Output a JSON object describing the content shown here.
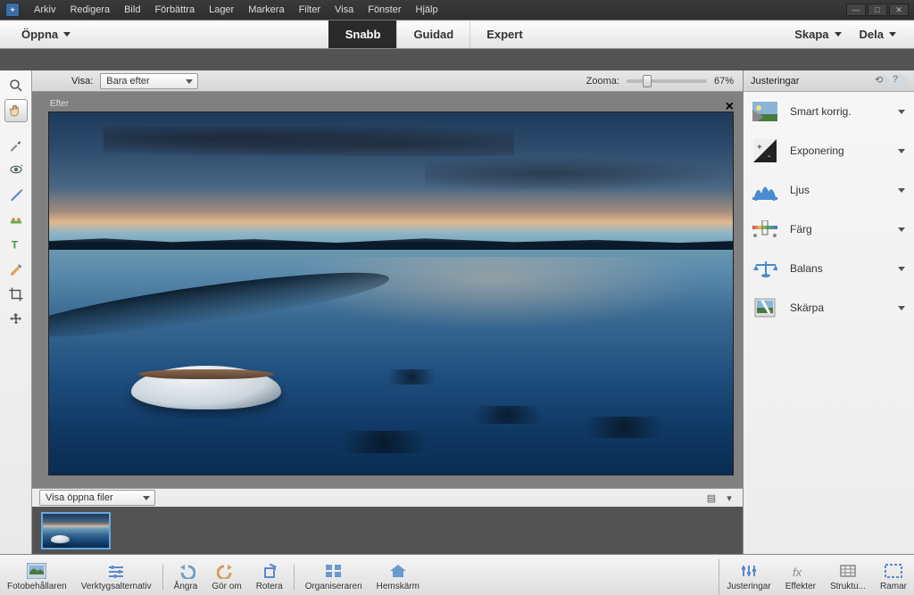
{
  "menu": [
    "Arkiv",
    "Redigera",
    "Bild",
    "Förbättra",
    "Lager",
    "Markera",
    "Filter",
    "Visa",
    "Fönster",
    "Hjälp"
  ],
  "modebar": {
    "open": "Öppna",
    "tabs": [
      "Snabb",
      "Guidad",
      "Expert"
    ],
    "active_tab": 0,
    "create": "Skapa",
    "share": "Dela"
  },
  "options": {
    "view_label": "Visa:",
    "view_value": "Bara efter",
    "zoom_label": "Zooma:",
    "zoom_value": "67%"
  },
  "tools": [
    "zoom",
    "hand",
    "eyedropper",
    "redeye",
    "whiten",
    "spot",
    "type",
    "brush",
    "crop",
    "move"
  ],
  "active_tool": 1,
  "canvas": {
    "label": "Efter",
    "close": "×"
  },
  "project": {
    "selector": "Visa öppna filer"
  },
  "rightpanel": {
    "header": "Justeringar",
    "items": [
      {
        "id": "smartfix",
        "label": "Smart korrig."
      },
      {
        "id": "exposure",
        "label": "Exponering"
      },
      {
        "id": "light",
        "label": "Ljus"
      },
      {
        "id": "color",
        "label": "Färg"
      },
      {
        "id": "balance",
        "label": "Balans"
      },
      {
        "id": "sharpen",
        "label": "Skärpa"
      }
    ]
  },
  "bottombar": {
    "left": [
      {
        "id": "photobin",
        "label": "Fotobehållaren"
      },
      {
        "id": "toolopts",
        "label": "Verktygsalternativ"
      },
      {
        "id": "undo",
        "label": "Ångra"
      },
      {
        "id": "redo",
        "label": "Gör om"
      },
      {
        "id": "rotate",
        "label": "Rotera"
      },
      {
        "id": "organizer",
        "label": "Organiseraren"
      },
      {
        "id": "home",
        "label": "Hemskärm"
      }
    ],
    "right": [
      {
        "id": "adjust",
        "label": "Justeringar"
      },
      {
        "id": "effects",
        "label": "Effekter"
      },
      {
        "id": "textures",
        "label": "Struktu..."
      },
      {
        "id": "frames",
        "label": "Ramar"
      }
    ]
  }
}
